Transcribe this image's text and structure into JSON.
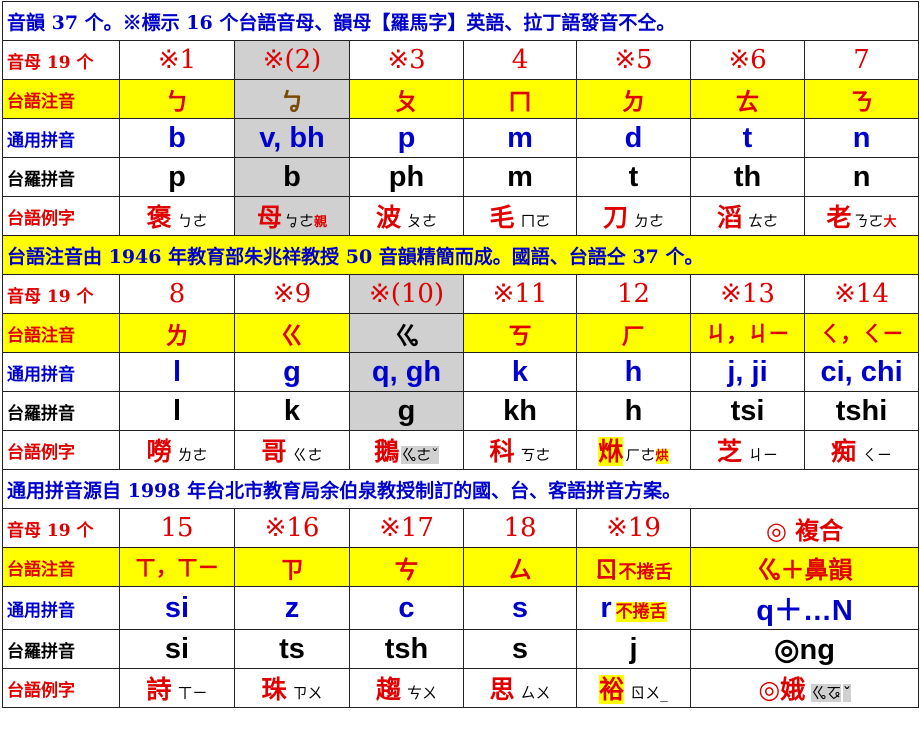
{
  "row_headers": {
    "initials": "音母 19 个",
    "zhuyin": "台語注音",
    "tongyong": "通用拼音",
    "poj": "台羅拼音",
    "examples": "台語例字"
  },
  "banner1": "音韻 37 个。※標示 16 个台語音母、韻母【羅馬字】英語、拉丁語發音不仝。",
  "banner2": "台語注音由 1946 年教育部朱兆祥教授 50 音韻精簡而成。國語、台語仝 37 个。",
  "banner3": "通用拼音源自 1998 年台北市教育局余伯泉教授制訂的國、台、客語拼音方案。",
  "block1": {
    "numbers": [
      "※1",
      "※(2)",
      "※3",
      "4",
      "※5",
      "※6",
      "7"
    ],
    "zhuyin": [
      "ㄅ",
      "ㆠ",
      "ㄆ",
      "ㄇ",
      "ㄉ",
      "ㄊ",
      "ㄋ"
    ],
    "tongyong": [
      "b",
      "v, bh",
      "p",
      "m",
      "d",
      "t",
      "n"
    ],
    "poj": [
      "p",
      "b",
      "ph",
      "m",
      "t",
      "th",
      "n"
    ],
    "examples": [
      {
        "char": "褒",
        "zy": "ㄅㄜ",
        "tag": ""
      },
      {
        "char": "母",
        "zy": "ㆠㄜ",
        "tag": "親"
      },
      {
        "char": "波",
        "zy": "ㄆㄜ",
        "tag": ""
      },
      {
        "char": "毛",
        "zy": "ㄇㄛ",
        "tag": ""
      },
      {
        "char": "刀",
        "zy": "ㄉㄜ",
        "tag": ""
      },
      {
        "char": "滔",
        "zy": "ㄊㄜ",
        "tag": ""
      },
      {
        "char": "老",
        "zy": "ㄋㄛ",
        "tag": "大"
      }
    ]
  },
  "block2": {
    "numbers": [
      "8",
      "※9",
      "※(10)",
      "※11",
      "12",
      "※13",
      "※14"
    ],
    "zhuyin": [
      "ㄌ",
      "ㄍ",
      "ㆣ",
      "ㄎ",
      "ㄏ",
      "ㄐ，ㄐㄧ",
      "ㄑ，ㄑㄧ"
    ],
    "tongyong": [
      "l",
      "g",
      "q, gh",
      "k",
      "h",
      "j, ji",
      "ci, chi"
    ],
    "poj": [
      "l",
      "k",
      "g",
      "kh",
      "h",
      "tsi",
      "tshi"
    ],
    "examples": [
      {
        "char": "嘮",
        "zy": "ㄌㄜ",
        "tag": ""
      },
      {
        "char": "哥",
        "zy": "ㄍㄜ",
        "tag": ""
      },
      {
        "char": "鵝",
        "zy": "ㆣㄜˇ",
        "tag": ""
      },
      {
        "char": "科",
        "zy": "ㄎㄜ",
        "tag": ""
      },
      {
        "char": "烌",
        "zy": "ㄏㄜ",
        "tag": "烘"
      },
      {
        "char": "芝",
        "zy": "ㄐㄧ",
        "tag": ""
      },
      {
        "char": "痴",
        "zy": "ㄑㄧ",
        "tag": ""
      }
    ]
  },
  "block3": {
    "numbers": [
      "15",
      "※16",
      "※17",
      "18",
      "※19",
      "◎ 複合"
    ],
    "zhuyin": [
      "ㄒ，ㄒㄧ",
      "ㄗ",
      "ㄘ",
      "ㄙ",
      "ㄖ",
      "ㆣ＋鼻韻"
    ],
    "zhuyin_note": "不捲舌",
    "tongyong": [
      "si",
      "z",
      "c",
      "s",
      "r",
      "q＋…N"
    ],
    "tongyong_note": "不捲舌",
    "poj": [
      "si",
      "ts",
      "tsh",
      "s",
      "j",
      "◎ng"
    ],
    "examples": [
      {
        "char": "詩",
        "zy": "ㄒㄧ",
        "tag": ""
      },
      {
        "char": "珠",
        "zy": "ㄗㄨ",
        "tag": ""
      },
      {
        "char": "趨",
        "zy": "ㄘㄨ",
        "tag": ""
      },
      {
        "char": "思",
        "zy": "ㄙㄨ",
        "tag": ""
      },
      {
        "char": "裕",
        "zy": "ㄖㄨ_",
        "tag": ""
      },
      {
        "char": "◎娥",
        "zy": "ㆣㆧ",
        "tag": "ˇ"
      }
    ]
  },
  "colors": {
    "red": "#e00000",
    "blue": "#0000cc",
    "yellow": "#ffff00",
    "grey": "#d0d0d0"
  }
}
